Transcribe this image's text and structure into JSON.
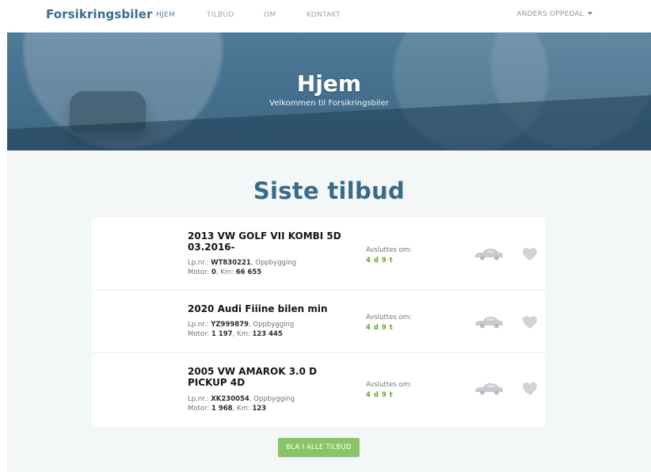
{
  "nav": {
    "brand": "Forsikringsbiler",
    "links": [
      "HJEM",
      "TILBUD",
      "OM",
      "KONTAKT"
    ],
    "user": "ANDERS OPPEDAL"
  },
  "hero": {
    "title": "Hjem",
    "subtitle": "Velkommen til Forsikringsbiler"
  },
  "section": {
    "title": "Siste tilbud",
    "cta": "BLA I ALLE TILBUD"
  },
  "listings": [
    {
      "title": "2013 VW GOLF VII KOMBI 5D 03.2016-",
      "lp_label": "Lp.nr.:",
      "lp": "WT830221",
      "status": "Oppbygging",
      "motor_label": "Motor:",
      "motor": "0",
      "km_label": "Km:",
      "km": "66 655",
      "ends_label": "Avsluttes om:",
      "ends_value": "4 d 9 t"
    },
    {
      "title": "2020 Audi Fiiine bilen min",
      "lp_label": "Lp.nr.:",
      "lp": "YZ999879",
      "status": "Oppbygging",
      "motor_label": "Motor:",
      "motor": "1 197",
      "km_label": "Km:",
      "km": "123 445",
      "ends_label": "Avsluttes om:",
      "ends_value": "4 d 9 t"
    },
    {
      "title": "2005 VW AMAROK 3.0 D PICKUP 4D",
      "lp_label": "Lp.nr.:",
      "lp": "XK230054",
      "status": "Oppbygging",
      "motor_label": "Motor:",
      "motor": "1 968",
      "km_label": "Km:",
      "km": "123",
      "ends_label": "Avsluttes om:",
      "ends_value": "4 d 9 t"
    }
  ],
  "icons": {
    "car": "car-icon",
    "heart": "heart-icon",
    "caret": "chevron-down-icon"
  },
  "colors": {
    "brand": "#3b6d8c",
    "heading": "#376b88",
    "accent_green": "#6aa32e",
    "cta_green": "#8ac467"
  }
}
